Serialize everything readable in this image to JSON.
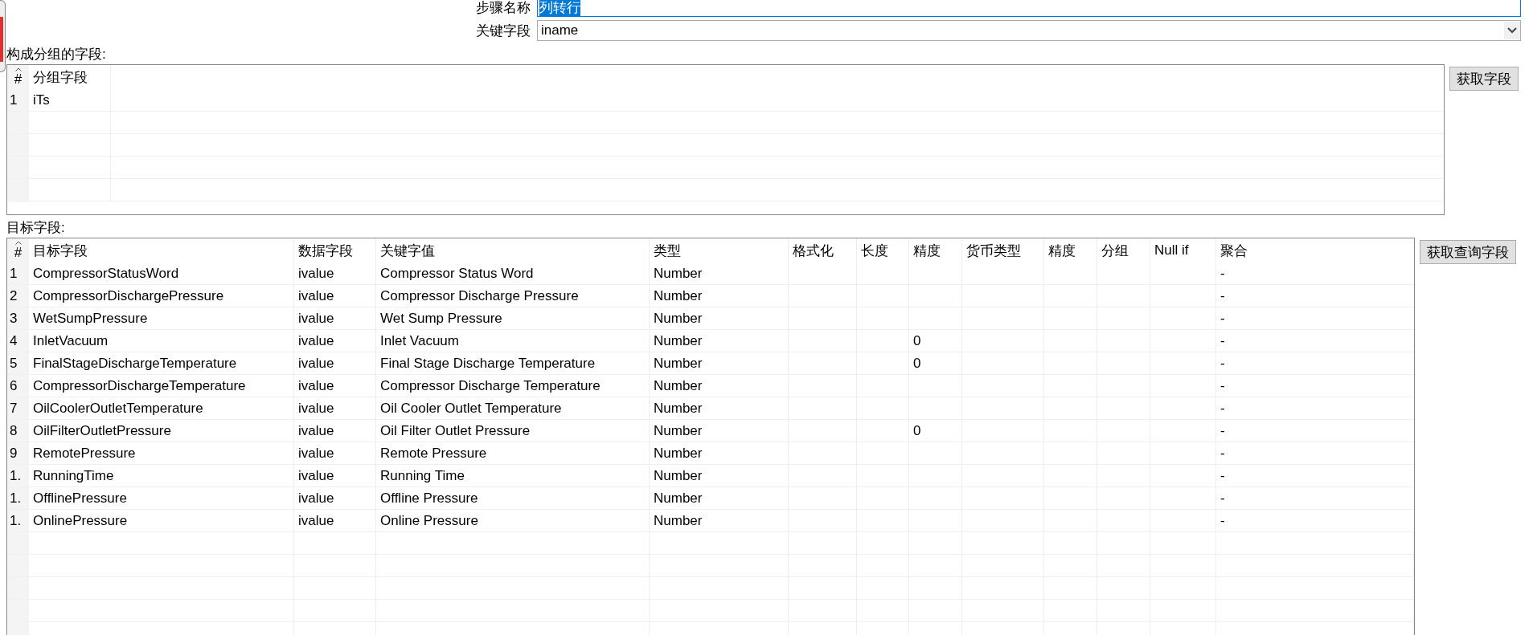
{
  "step_name": {
    "label": "步骤名称",
    "value": "列转行",
    "text_selected": true
  },
  "key_field": {
    "label": "关键字段",
    "value": "iname"
  },
  "group_section": {
    "title": "构成分组的字段:",
    "columns": [
      "#",
      "分组字段"
    ],
    "rows": [
      {
        "num": "1",
        "field": "iTs"
      }
    ],
    "button": "获取字段"
  },
  "target_section": {
    "title": "目标字段:",
    "columns": [
      "#",
      "目标字段",
      "数据字段",
      "关键字值",
      "类型",
      "格式化",
      "长度",
      "精度",
      "货币类型",
      "精度",
      "分组",
      "Null if",
      "聚合"
    ],
    "rows": [
      {
        "num": "1",
        "target": "CompressorStatusWord",
        "data_field": "ivalue",
        "key_value": "Compressor Status Word",
        "type": "Number",
        "aggregation": "-"
      },
      {
        "num": "2",
        "target": "CompressorDischargePressure",
        "data_field": "ivalue",
        "key_value": "Compressor Discharge Pressure",
        "type": "Number",
        "aggregation": "-"
      },
      {
        "num": "3",
        "target": "WetSumpPressure",
        "data_field": "ivalue",
        "key_value": "Wet Sump Pressure",
        "type": "Number",
        "aggregation": "-"
      },
      {
        "num": "4",
        "target": "InletVacuum",
        "data_field": "ivalue",
        "key_value": "Inlet Vacuum",
        "type": "Number",
        "precision": "0",
        "aggregation": "-"
      },
      {
        "num": "5",
        "target": "FinalStageDischargeTemperature",
        "data_field": "ivalue",
        "key_value": "Final Stage Discharge Temperature",
        "type": "Number",
        "precision": "0",
        "aggregation": "-"
      },
      {
        "num": "6",
        "target": "CompressorDischargeTemperature",
        "data_field": "ivalue",
        "key_value": "Compressor Discharge Temperature",
        "type": "Number",
        "aggregation": "-"
      },
      {
        "num": "7",
        "target": "OilCoolerOutletTemperature",
        "data_field": "ivalue",
        "key_value": "Oil Cooler Outlet Temperature",
        "type": "Number",
        "aggregation": "-"
      },
      {
        "num": "8",
        "target": "OilFilterOutletPressure",
        "data_field": "ivalue",
        "key_value": "Oil Filter Outlet Pressure",
        "type": "Number",
        "precision": "0",
        "aggregation": "-"
      },
      {
        "num": "9",
        "target": "RemotePressure",
        "data_field": "ivalue",
        "key_value": "Remote Pressure",
        "type": "Number",
        "aggregation": "-"
      },
      {
        "num": "1.",
        "target": "RunningTime",
        "data_field": "ivalue",
        "key_value": "Running Time",
        "type": "Number",
        "aggregation": "-"
      },
      {
        "num": "1.",
        "target": "OfflinePressure",
        "data_field": "ivalue",
        "key_value": "Offline Pressure",
        "type": "Number",
        "aggregation": "-"
      },
      {
        "num": "1.",
        "target": "OnlinePressure",
        "data_field": "ivalue",
        "key_value": "Online Pressure",
        "type": "Number",
        "aggregation": "-"
      }
    ],
    "button": "获取查询字段"
  }
}
